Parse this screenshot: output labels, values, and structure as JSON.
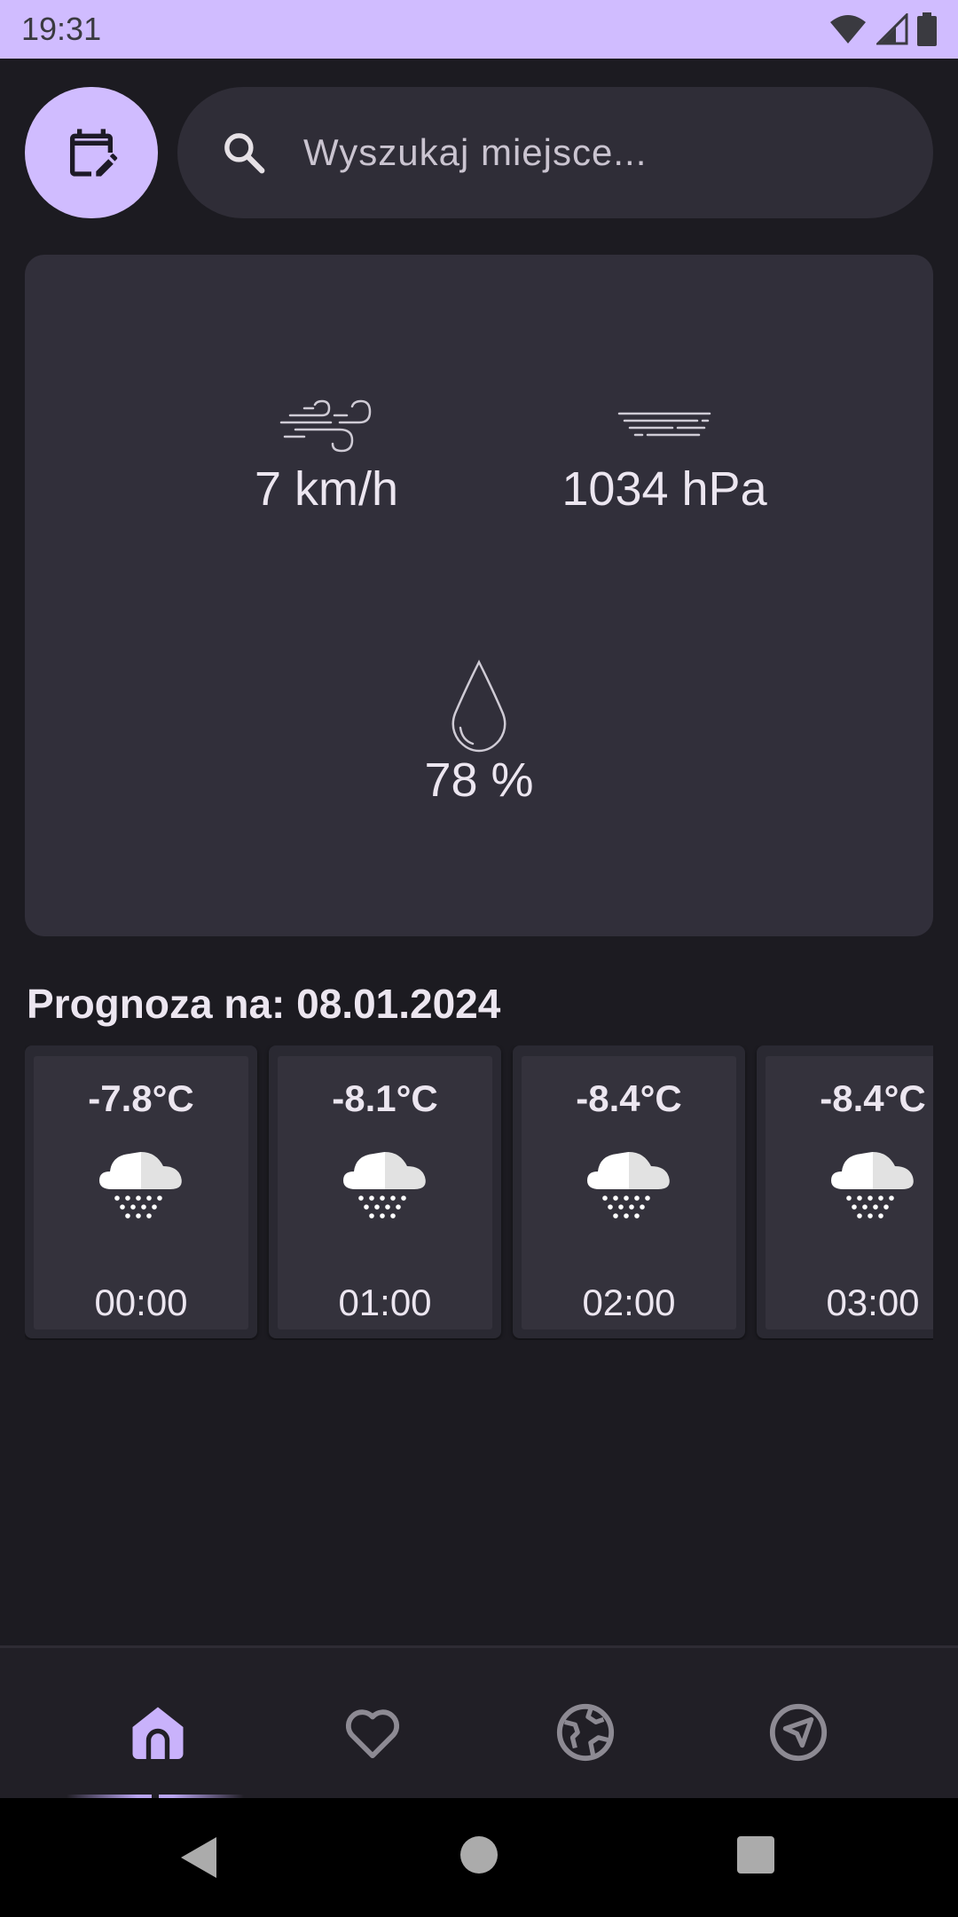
{
  "status_bar": {
    "time": "19:31",
    "icons": [
      "wifi-icon",
      "cell-signal-icon",
      "battery-icon"
    ]
  },
  "header": {
    "calendar_button_icon": "calendar-edit-icon",
    "search": {
      "icon": "search-icon",
      "placeholder": "Wyszukaj miejsce..."
    }
  },
  "details": {
    "wind": {
      "icon": "wind-icon",
      "value": "7 km/h"
    },
    "pressure": {
      "icon": "pressure-icon",
      "value": "1034 hPa"
    },
    "humidity": {
      "icon": "droplet-icon",
      "value": "78 %"
    }
  },
  "forecast": {
    "title": "Prognoza na: 08.01.2024",
    "hours": [
      {
        "temp": "-7.8°C",
        "icon": "snow-cloud-icon",
        "time": "00:00"
      },
      {
        "temp": "-8.1°C",
        "icon": "snow-cloud-icon",
        "time": "01:00"
      },
      {
        "temp": "-8.4°C",
        "icon": "snow-cloud-icon",
        "time": "02:00"
      },
      {
        "temp": "-8.4°C",
        "icon": "snow-cloud-icon",
        "time": "03:00"
      }
    ]
  },
  "bottom_nav": {
    "items": [
      {
        "icon": "home-icon",
        "active": true
      },
      {
        "icon": "heart-icon",
        "active": false
      },
      {
        "icon": "globe-icon",
        "active": false
      },
      {
        "icon": "navigation-icon",
        "active": false
      }
    ]
  },
  "colors": {
    "accent": "#d0bcff",
    "background": "#1c1b21",
    "card": "#312f3a",
    "text": "#ece6f0"
  }
}
